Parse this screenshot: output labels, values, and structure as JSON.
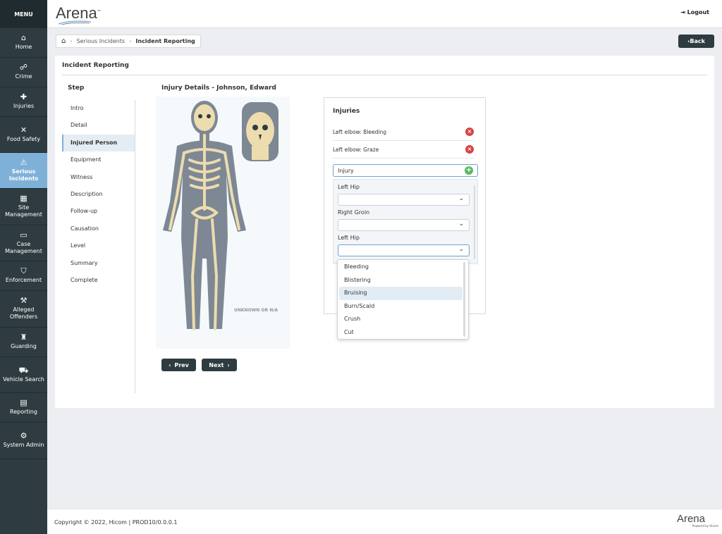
{
  "sidebar": {
    "menu": "MENU",
    "items": [
      {
        "label": "Home",
        "icon": "home-icon",
        "glyph": "⌂"
      },
      {
        "label": "Crime",
        "icon": "handcuffs-icon",
        "glyph": "☍"
      },
      {
        "label": "Injuries",
        "icon": "injury-icon",
        "glyph": "✚"
      },
      {
        "label": "Food Safety",
        "icon": "utensils-icon",
        "glyph": "✕"
      },
      {
        "label": "Serious Incidents",
        "icon": "warning-icon",
        "glyph": "⚠"
      },
      {
        "label": "Site Management",
        "icon": "store-icon",
        "glyph": "▦"
      },
      {
        "label": "Case Management",
        "icon": "folder-icon",
        "glyph": "▭"
      },
      {
        "label": "Enforcement",
        "icon": "shield-icon",
        "glyph": "⛉"
      },
      {
        "label": "Alleged Offenders",
        "icon": "gavel-icon",
        "glyph": "⚒"
      },
      {
        "label": "Guarding",
        "icon": "guard-icon",
        "glyph": "♜"
      },
      {
        "label": "Vehicle Search",
        "icon": "car-icon",
        "glyph": "⛟"
      },
      {
        "label": "Reporting",
        "icon": "calendar-report-icon",
        "glyph": "▤"
      },
      {
        "label": "System Admin",
        "icon": "gear-icon",
        "glyph": "⚙"
      }
    ]
  },
  "header": {
    "logo": "Arena",
    "tm": "™",
    "logout": "Logout"
  },
  "breadcrumb": {
    "items": [
      "Serious Incidents",
      "Incident Reporting"
    ]
  },
  "back_label": "Back",
  "panel": {
    "title": "Incident Reporting",
    "step_heading": "Step",
    "steps": [
      "Intro",
      "Detail",
      "Injured Person",
      "Equipment",
      "Witness",
      "Description",
      "Follow-up",
      "Causation",
      "Level",
      "Summary",
      "Complete"
    ],
    "active_step": "Injured Person",
    "section_title": "Injury Details - Johnson, Edward",
    "figure_label": "UNKNOWN OR N/A",
    "prev": "Prev",
    "next": "Next"
  },
  "injuries": {
    "heading": "Injuries",
    "list": [
      "Left elbow:  Bleeding",
      "Left elbow:  Graze"
    ],
    "input_placeholder": "Injury",
    "locations": [
      {
        "label": "Left Hip",
        "value": ""
      },
      {
        "label": "Right Groin",
        "value": ""
      },
      {
        "label": "Left Hip",
        "value": ""
      }
    ],
    "dropdown_options": [
      "Bleeding",
      "Blistering",
      "Bruising",
      "Burn/Scald",
      "Crush",
      "Cut"
    ],
    "highlighted_option": "Bruising"
  },
  "footer": {
    "copyright": "Copyright © 2022, Hicom | PROD10/0.0.0.1",
    "logo": "Arena",
    "powered": "Powered by Hicom"
  }
}
